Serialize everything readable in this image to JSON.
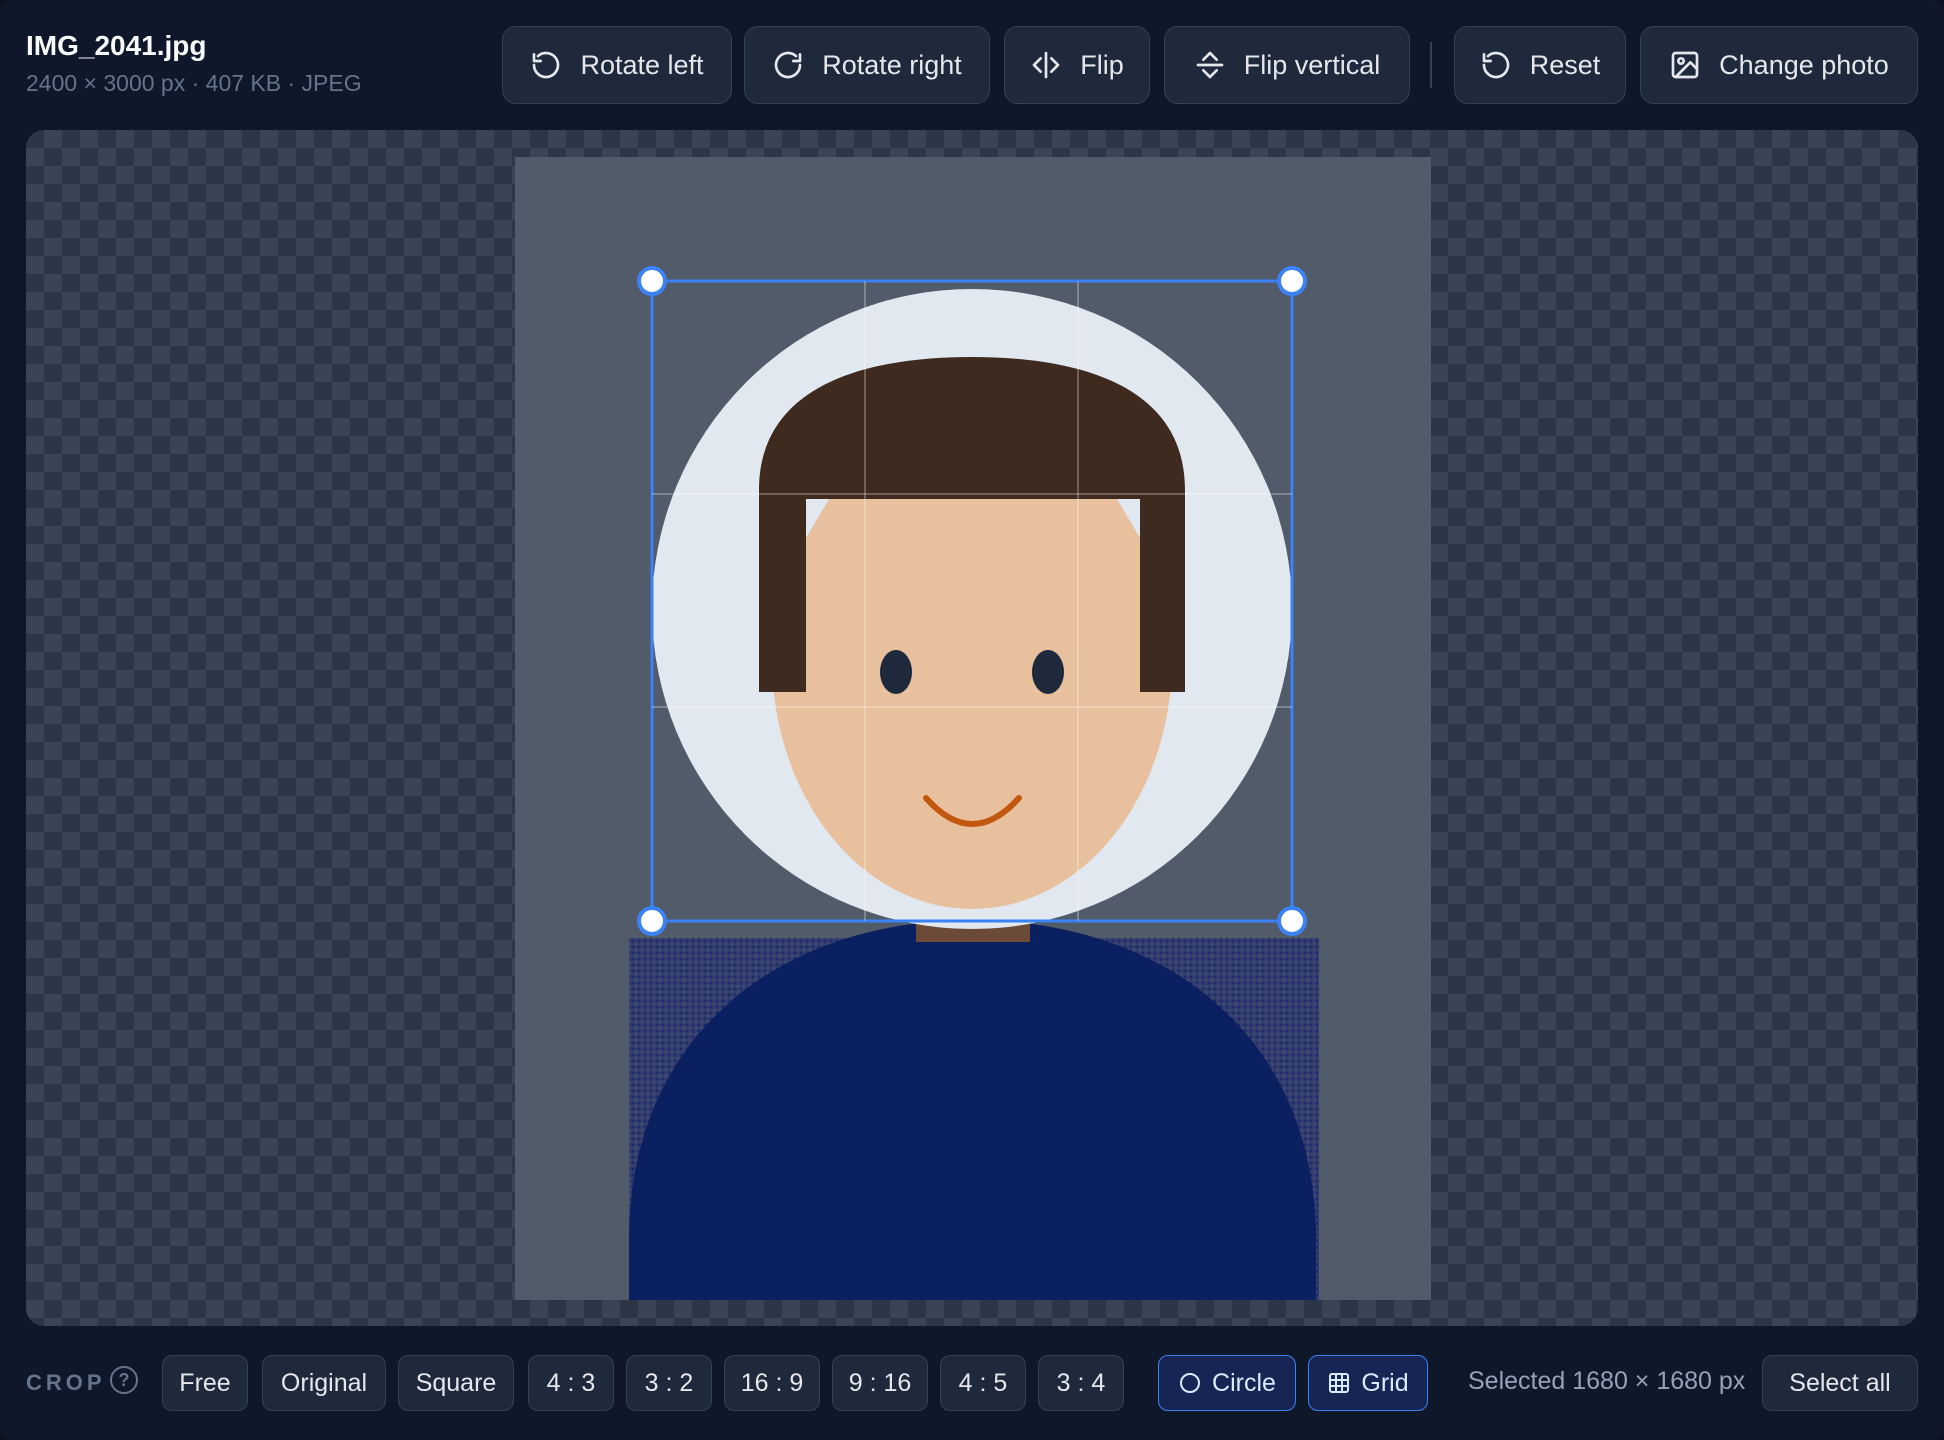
{
  "file": {
    "name": "IMG_2041.jpg",
    "meta": "2400 × 3000 px · 407 KB · JPEG"
  },
  "toolbar": {
    "rotate_left": "Rotate left",
    "rotate_right": "Rotate right",
    "flip": "Flip",
    "flip_vertical": "Flip vertical",
    "reset": "Reset",
    "change_photo": "Change photo"
  },
  "crop_bar": {
    "label": "CROP",
    "help": "?",
    "options": [
      {
        "label": "Free",
        "active": false
      },
      {
        "label": "Original",
        "active": false
      },
      {
        "label": "Square",
        "active": false
      },
      {
        "label": "4 : 3",
        "active": false
      },
      {
        "label": "3 : 2",
        "active": false
      },
      {
        "label": "16 : 9",
        "active": false
      },
      {
        "label": "9 : 16",
        "active": false
      },
      {
        "label": "4 : 5",
        "active": false
      },
      {
        "label": "3 : 4",
        "active": false
      }
    ],
    "circle": "Circle",
    "grid": "Grid",
    "circle_active": true,
    "grid_active": true,
    "selected": "Selected 1680 × 1680 px",
    "select_all": "Select all"
  },
  "colors": {
    "accent": "#3b82f6",
    "photo_background": "#525b6a",
    "skin": "#e9c09e",
    "hair": "#3e2a1f",
    "shirt": "#0b2060",
    "eyes": "#1e293b",
    "smile": "#c2570f"
  }
}
